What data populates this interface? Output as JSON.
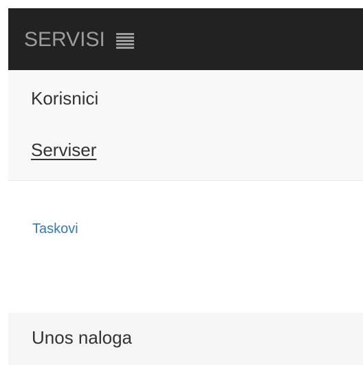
{
  "navbar": {
    "brand": "SERVISI",
    "toggle_icon": "hamburger-menu-icon",
    "bg_color": "#222222",
    "text_color": "#9d9d9d"
  },
  "menu": {
    "items": [
      {
        "label": "Korisnici"
      },
      {
        "label": "Serviser"
      }
    ]
  },
  "main": {
    "link": "Taskovi",
    "link_color": "#337ab7"
  },
  "footer_panel": {
    "label": "Unos naloga"
  }
}
